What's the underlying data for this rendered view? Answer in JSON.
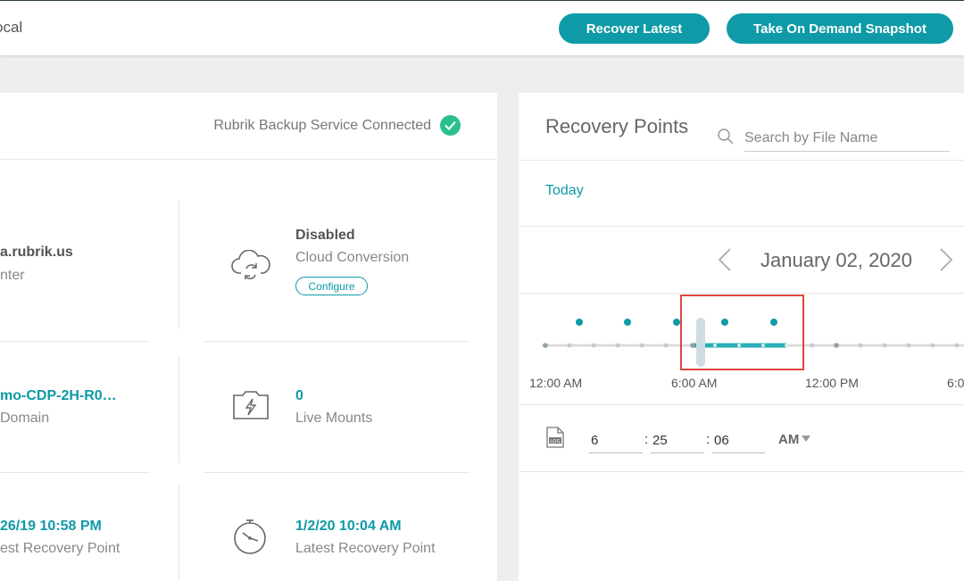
{
  "topbar": {
    "title": "ocal",
    "recover_label": "Recover Latest",
    "snapshot_label": "Take On Demand Snapshot"
  },
  "overview": {
    "status_text": "Rubrik Backup Service Connected",
    "stats": [
      {
        "value": "a.rubrik.us",
        "label": "nter"
      },
      {
        "value": "Disabled",
        "label": "Cloud Conversion",
        "action": "Configure"
      },
      {
        "value": "mo-CDP-2H-R0…",
        "label": "Domain"
      },
      {
        "value": "0",
        "label": "Live Mounts"
      },
      {
        "value": "26/19 10:58 PM",
        "label": "est Recovery Point"
      },
      {
        "value": "1/2/20 10:04 AM",
        "label": "Latest Recovery Point"
      }
    ]
  },
  "recovery": {
    "title": "Recovery Points",
    "search_placeholder": "Search by File Name",
    "range_label": "Today",
    "date": "January 02, 2020",
    "timeline_labels": [
      "12:00 AM",
      "6:00 AM",
      "12:00 PM",
      "6:0"
    ],
    "time": {
      "hour": "6",
      "minute": "25",
      "second": "06",
      "ampm": "AM"
    }
  },
  "colors": {
    "accent": "#0e9aa7",
    "success": "#2bbf8f",
    "highlight": "#e0453d"
  }
}
